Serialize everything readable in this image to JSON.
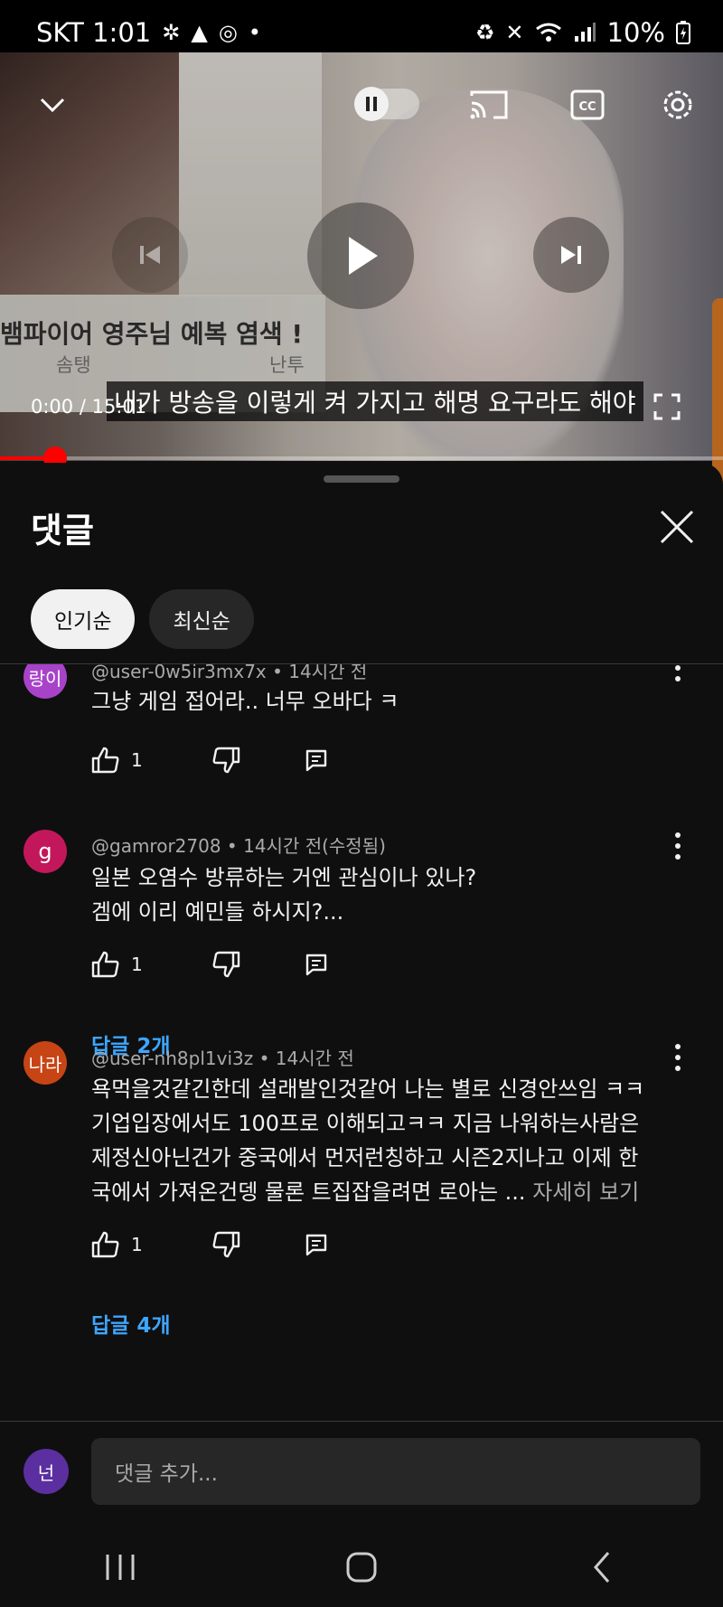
{
  "status_bar": {
    "carrier_time": "SKT 1:01",
    "battery": "10%"
  },
  "video": {
    "caption_title": "뱀파이어 영주님   예복 염색 !",
    "caption_author_1": "솜탱",
    "caption_author_2": "난투",
    "subtitle": "내가 방송을 이렇게 켜 가지고 해명 요구라도 해야",
    "current_time": "0:00",
    "separator": "/",
    "duration": "15:01",
    "progress": 0.076
  },
  "comments_panel": {
    "title": "댓글",
    "sort_chips": [
      {
        "label": "인기순",
        "active": true
      },
      {
        "label": "최신순",
        "active": false
      }
    ],
    "comments": [
      {
        "avatar_text": "랑이",
        "avatar_color": "#a843c9",
        "author": "@user-0w5ir3mx7x",
        "time": "14시간 전",
        "text": "그냥 게임 접어라.. 너무 오바다 ㅋ",
        "see_more": "",
        "likes": "1",
        "replies_label": ""
      },
      {
        "avatar_text": "g",
        "avatar_color": "#c2185b",
        "author": "@gamror2708",
        "time": "14시간 전(수정됨)",
        "text": "일본 오염수 방류하는 거엔 관심이나 있나?\n겜에  이리 예민들 하시지?...",
        "see_more": "",
        "likes": "1",
        "replies_label": "답글 2개"
      },
      {
        "avatar_text": "나라",
        "avatar_color": "#c74414",
        "author": "@user-nh8pl1vi3z",
        "time": "14시간 전",
        "text": "욕먹을것같긴한데 설래발인것같어 나는 별로 신경안쓰임 ㅋㅋ\n기업입장에서도 100프로 이해되고ㅋㅋ  지금 나워하는사람은\n제정신아닌건가 중국에서 먼저런칭하고 시즌2지나고 이제 한\n국에서 가져온건뎅  물론 트집잡을려면 로아는 ...",
        "see_more": "자세히 보기",
        "likes": "1",
        "replies_label": "답글 4개"
      }
    ],
    "input": {
      "avatar_text": "넌",
      "placeholder": "댓글 추가..."
    }
  },
  "colors": {
    "background": "#0f0f0f",
    "accent_red": "#ff0000",
    "link_blue": "#3ea6ff"
  }
}
